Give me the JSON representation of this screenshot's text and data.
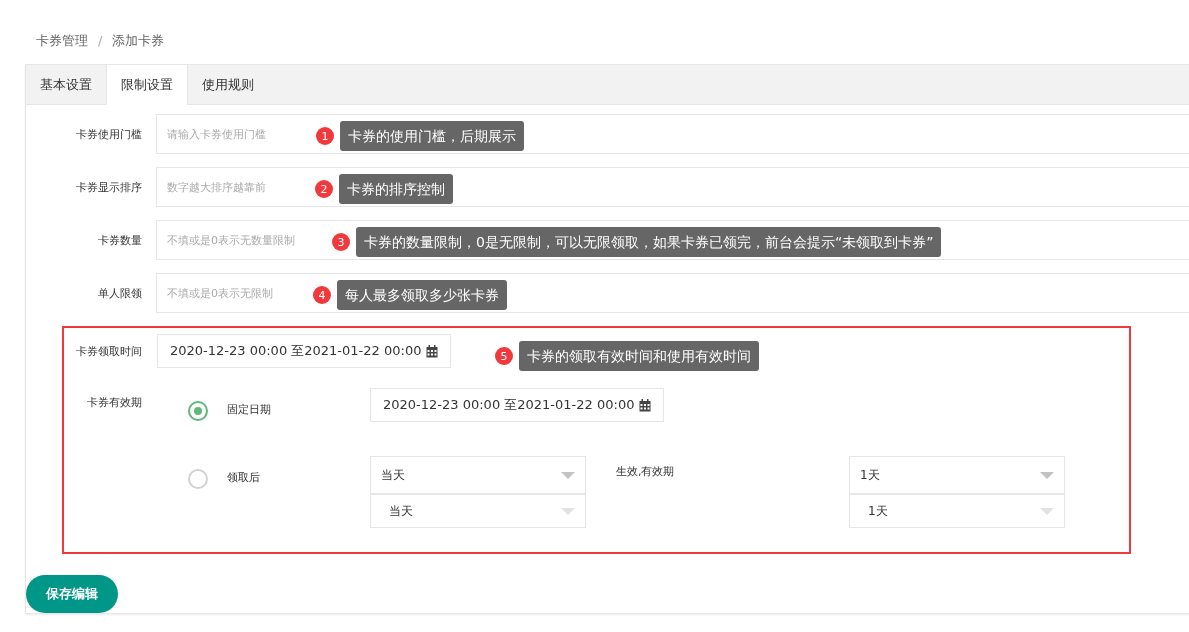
{
  "breadcrumb": {
    "items": [
      "卡券管理",
      "添加卡券"
    ],
    "separator": "/"
  },
  "tabs": [
    {
      "label": "基本设置",
      "selected": false
    },
    {
      "label": "限制设置",
      "selected": true
    },
    {
      "label": "使用规则",
      "selected": false
    }
  ],
  "fields": [
    {
      "label": "卡券使用门槛",
      "placeholder": "请输入卡券使用门槛",
      "note": {
        "number": "1",
        "text": "卡券的使用门槛，后期展示"
      }
    },
    {
      "label": "卡券显示排序",
      "placeholder": "数字越大排序越靠前",
      "note": {
        "number": "2",
        "text": "卡券的排序控制"
      }
    },
    {
      "label": "卡券数量",
      "placeholder": "不填或是0表示无数量限制",
      "note": {
        "number": "3",
        "text": "卡券的数量限制，0是无限制，可以无限领取，如果卡券已领完，前台会提示“未领取到卡券”"
      }
    },
    {
      "label": "单人限领",
      "placeholder": "不填或是0表示无限制",
      "note": {
        "number": "4",
        "text": "每人最多领取多少张卡券"
      }
    }
  ],
  "receive_time": {
    "label": "卡券领取时间",
    "value": "2020-12-23 00:00 至2021-01-22 00:00",
    "note": {
      "number": "5",
      "text": "卡券的领取有效时间和使用有效时间"
    }
  },
  "validity": {
    "label": "卡券有效期",
    "options": [
      {
        "kind": "date",
        "label": "固定日期",
        "selected": true,
        "value": "2020-12-23 00:00 至2021-01-22 00:00"
      },
      {
        "kind": "relative",
        "label": "领取后",
        "selected": false,
        "start": [
          "当天",
          "当天"
        ],
        "middle_label": "生效,有效期",
        "duration": [
          "1天",
          "1天"
        ]
      }
    ]
  },
  "save_button": "保存编辑"
}
